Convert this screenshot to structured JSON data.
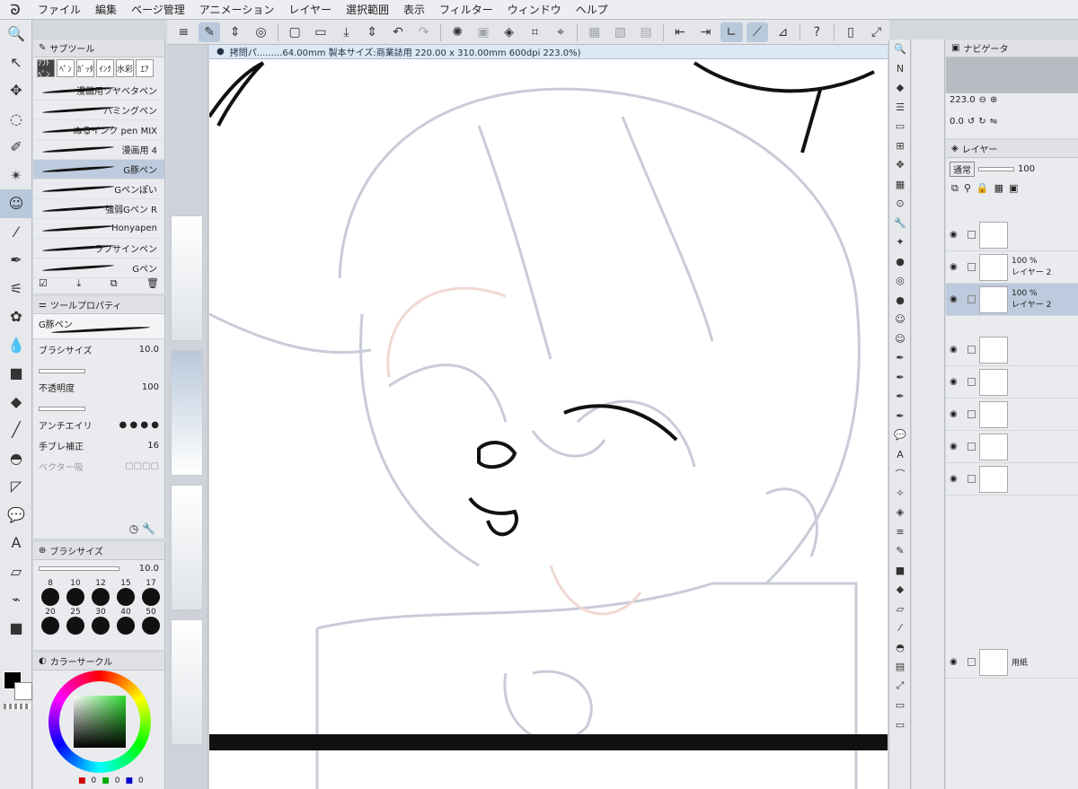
{
  "menu": [
    "ファイル",
    "編集",
    "ページ管理",
    "アニメーション",
    "レイヤー",
    "選択範囲",
    "表示",
    "フィルター",
    "ウィンドウ",
    "ヘルプ"
  ],
  "subtool": {
    "title": "サブツール",
    "tabs": [
      "ｿﾌﾄﾍﾟﾝ",
      "ﾍﾟﾝ",
      "ｶﾞｯﾀ",
      "ｲﾝｸ",
      "水彩",
      "ｴｱ"
    ],
    "brushes": [
      "漫画用ツヤベタペン",
      "ハミングペン",
      "ぬるインク pen MIX",
      "漫画用 4",
      "G豚ペン",
      "Gペンぽい",
      "強弱Gペン R",
      "Honyapen",
      "ラフサインペン",
      "Gペン"
    ],
    "selected_index": 4
  },
  "toolprop": {
    "title": "ツールプロパティ",
    "brush_name": "G豚ペン",
    "size_label": "ブラシサイズ",
    "size_value": "10.0",
    "opacity_label": "不透明度",
    "opacity_value": "100",
    "aa_label": "アンチエイリ",
    "stab_label": "手ブレ補正",
    "stab_value": "16",
    "vector_label": "ベクター吸"
  },
  "brushsize": {
    "title": "ブラシサイズ",
    "value": "10.0",
    "sizes": [
      "8",
      "10",
      "12",
      "15",
      "17",
      "20",
      "25",
      "30",
      "40",
      "50"
    ]
  },
  "color": {
    "title": "カラーサークル",
    "r": "0",
    "g": "0",
    "b": "0"
  },
  "canvas": {
    "tab_title": "拷問パ.........64.00mm 製本サイズ:商業誌用 220.00 x 310.00mm 600dpi 223.0%)"
  },
  "navigator": {
    "title": "ナビゲータ",
    "zoom": "223.0",
    "angle": "0.0"
  },
  "layers": {
    "title": "レイヤー",
    "blend": "通常",
    "opacity": "100",
    "rows": [
      {
        "pct": "",
        "name": ""
      },
      {
        "pct": "100 %",
        "name": "レイヤー 2"
      },
      {
        "pct": "100 %",
        "name": "レイヤー 2"
      },
      {
        "pct": "",
        "name": ""
      },
      {
        "pct": "",
        "name": ""
      },
      {
        "pct": "",
        "name": ""
      },
      {
        "pct": "",
        "name": ""
      },
      {
        "pct": "",
        "name": ""
      },
      {
        "pct": "",
        "name": "用紙"
      }
    ],
    "selected_index": 2
  },
  "colors": {
    "selection": "#bccbdd",
    "sketch": "#c8ccd8",
    "ink": "#111111"
  }
}
